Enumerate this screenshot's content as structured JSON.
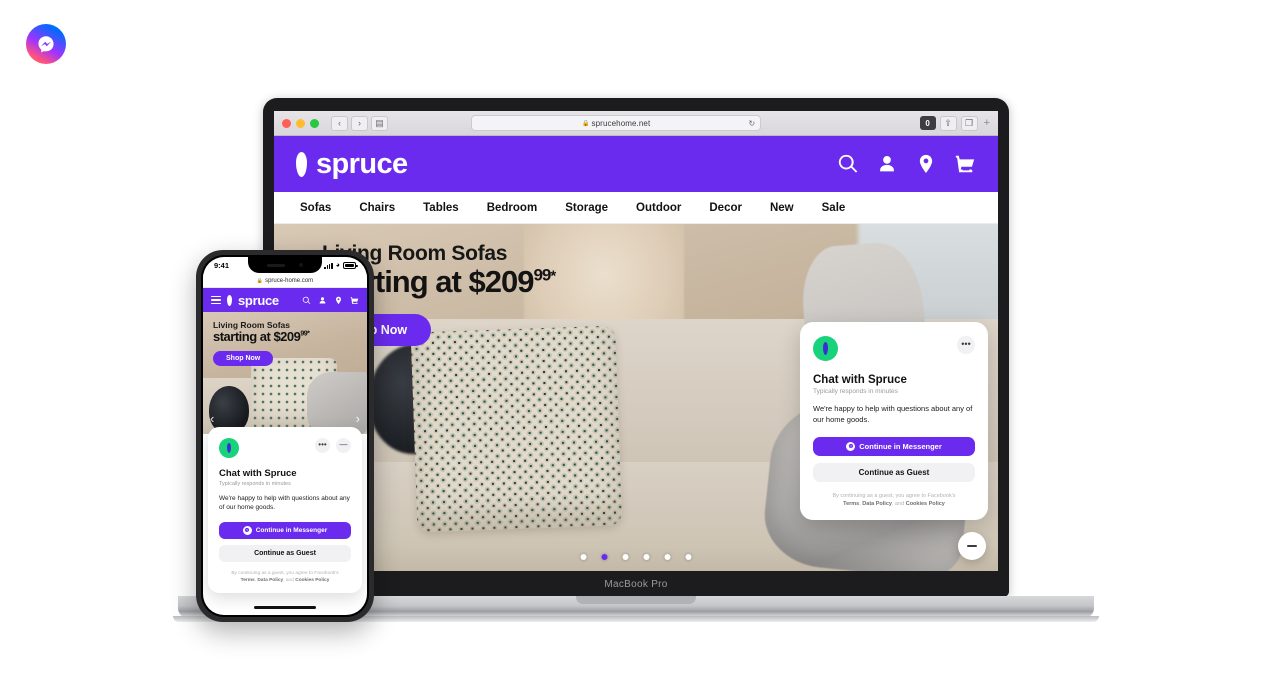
{
  "brand": {
    "messenger_logo": "messenger-logo",
    "accent_purple": "#6B2BEF",
    "avatar_green": "#19D27C"
  },
  "browser": {
    "url": "sprucehome.net",
    "lock_icon": "lock-icon",
    "reload_icon": "reload-icon",
    "back_icon": "chevron-left-icon",
    "forward_icon": "chevron-right-icon",
    "sidebar_icon": "sidebar-icon",
    "badge": "0",
    "share_icon": "share-icon",
    "tabs_icon": "tabs-icon",
    "new_tab": "+"
  },
  "site": {
    "logo_text": "spruce",
    "header_icons": [
      "search-icon",
      "account-icon",
      "location-icon",
      "cart-icon"
    ],
    "nav": [
      {
        "label": "Sofas"
      },
      {
        "label": "Chairs"
      },
      {
        "label": "Tables"
      },
      {
        "label": "Bedroom"
      },
      {
        "label": "Storage"
      },
      {
        "label": "Outdoor"
      },
      {
        "label": "Decor"
      },
      {
        "label": "New"
      },
      {
        "label": "Sale"
      }
    ],
    "hero": {
      "title": "Living Room Sofas",
      "subtitle_prefix": "starting at $209",
      "subtitle_cents": "99",
      "subtitle_star": "*",
      "cta": "Shop Now",
      "carousel_dots": 6,
      "carousel_active_index": 1
    }
  },
  "chat": {
    "avatar": "spruce-avatar",
    "more_icon": "•••",
    "minimize_icon": "—",
    "title": "Chat with Spruce",
    "subtitle": "Typically responds in minutes",
    "message": "We're happy to help with questions about any of our home goods.",
    "primary_button": "Continue in Messenger",
    "secondary_button": "Continue as Guest",
    "legal_prefix": "By continuing as a guest, you agree to Facebook's",
    "legal_terms": "Terms",
    "legal_comma": ", ",
    "legal_data": "Data Policy",
    "legal_and": ", and ",
    "legal_cookies": "Cookies Policy",
    "launcher_icon": "minimize-icon"
  },
  "macbook": {
    "model_label": "MacBook Pro"
  },
  "phone": {
    "status_time": "9:41",
    "signal_icon": "cellular-icon",
    "wifi_icon": "wifi-icon",
    "battery_icon": "battery-icon",
    "url": "spruce-home.com",
    "menu_icon": "hamburger-icon",
    "logo_text": "spruce",
    "hero": {
      "title": "Living Room Sofas",
      "subtitle_prefix": "starting at $209",
      "subtitle_cents": "99",
      "subtitle_star": "*",
      "cta": "Shop Now",
      "prev_icon": "‹",
      "next_icon": "›"
    }
  }
}
